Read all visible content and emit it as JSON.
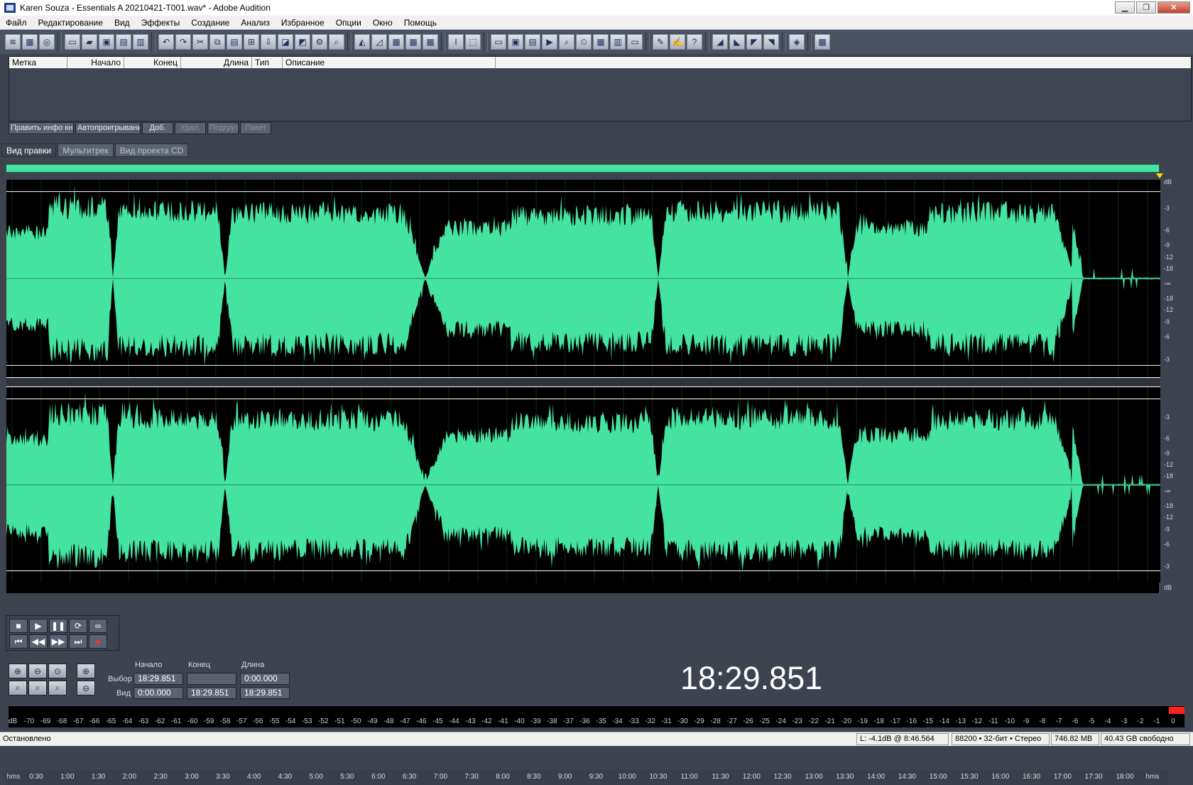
{
  "window": {
    "title": "Karen Souza - Essentials  A 20210421-T001.wav* - Adobe Audition"
  },
  "menu": [
    "Файл",
    "Редактирование",
    "Вид",
    "Эффекты",
    "Создание",
    "Анализ",
    "Избранное",
    "Опции",
    "Окно",
    "Помощь"
  ],
  "cue_list": {
    "columns": [
      "Метка",
      "Начало",
      "Конец",
      "Длина",
      "Тип",
      "Описание"
    ],
    "buttons": [
      "Править инфо кн",
      "Автопроигрывани",
      "Доб.",
      "Удал.",
      "Подгруз",
      "Пакет"
    ]
  },
  "tabs": [
    "Вид правки",
    "Мультитрек",
    "Вид проекта CD"
  ],
  "waveform": {
    "color": "#45e3a1",
    "background": "#000000",
    "channels": 2
  },
  "ruler": {
    "unit": "hms",
    "labels": [
      "0:30",
      "1:00",
      "1:30",
      "2:00",
      "2:30",
      "3:00",
      "3:30",
      "4:00",
      "4:30",
      "5:00",
      "5:30",
      "6:00",
      "6:30",
      "7:00",
      "7:30",
      "8:00",
      "8:30",
      "9:00",
      "9:30",
      "10:00",
      "10:30",
      "11:00",
      "11:30",
      "12:00",
      "12:30",
      "13:00",
      "13:30",
      "14:00",
      "14:30",
      "15:00",
      "15:30",
      "16:00",
      "16:30",
      "17:00",
      "17:30",
      "18:00"
    ],
    "end_label": "hms"
  },
  "db_scale": {
    "ch1": [
      "dB",
      "-3",
      "-6",
      "-9",
      "-12",
      "-18",
      "-∞",
      "-18",
      "-12",
      "-9",
      "-6",
      "-3"
    ],
    "ch2": [
      "-3",
      "-6",
      "-9",
      "-12",
      "-18",
      "-∞",
      "-18",
      "-12",
      "-9",
      "-6",
      "-3",
      "dB"
    ]
  },
  "transport": {
    "buttons": [
      "■",
      "▶",
      "❚❚",
      "⟳",
      "∞",
      "⏮",
      "◀◀",
      "▶▶",
      "⏭",
      "●"
    ]
  },
  "selection": {
    "headers": [
      "Начало",
      "Конец",
      "Длина"
    ],
    "row_labels": [
      "Выбор",
      "Вид"
    ],
    "select": {
      "start": "18:29.851",
      "end": "",
      "length": "0:00.000"
    },
    "view": {
      "start": "0:00.000",
      "end": "18:29.851",
      "length": "18:29.851"
    }
  },
  "time_display": "18:29.851",
  "level_meter": {
    "labels": [
      "dB",
      "-70",
      "-69",
      "-68",
      "-67",
      "-66",
      "-65",
      "-64",
      "-63",
      "-62",
      "-61",
      "-60",
      "-59",
      "-58",
      "-57",
      "-56",
      "-55",
      "-54",
      "-53",
      "-52",
      "-51",
      "-50",
      "-49",
      "-48",
      "-47",
      "-46",
      "-45",
      "-44",
      "-43",
      "-42",
      "-41",
      "-40",
      "-39",
      "-38",
      "-37",
      "-36",
      "-35",
      "-34",
      "-33",
      "-32",
      "-31",
      "-30",
      "-29",
      "-28",
      "-27",
      "-26",
      "-25",
      "-24",
      "-23",
      "-22",
      "-21",
      "-20",
      "-19",
      "-18",
      "-17",
      "-16",
      "-15",
      "-14",
      "-13",
      "-12",
      "-11",
      "-10",
      "-9",
      "-8",
      "-7",
      "-6",
      "-5",
      "-4",
      "-3",
      "-2",
      "-1",
      "0"
    ]
  },
  "status": {
    "state": "Остановлено",
    "cursor": "L: -4.1dB @   8:46.564",
    "format": "88200 • 32-бит • Стерео",
    "size": "746.82 MB",
    "free": "40.43 GB свободно"
  }
}
